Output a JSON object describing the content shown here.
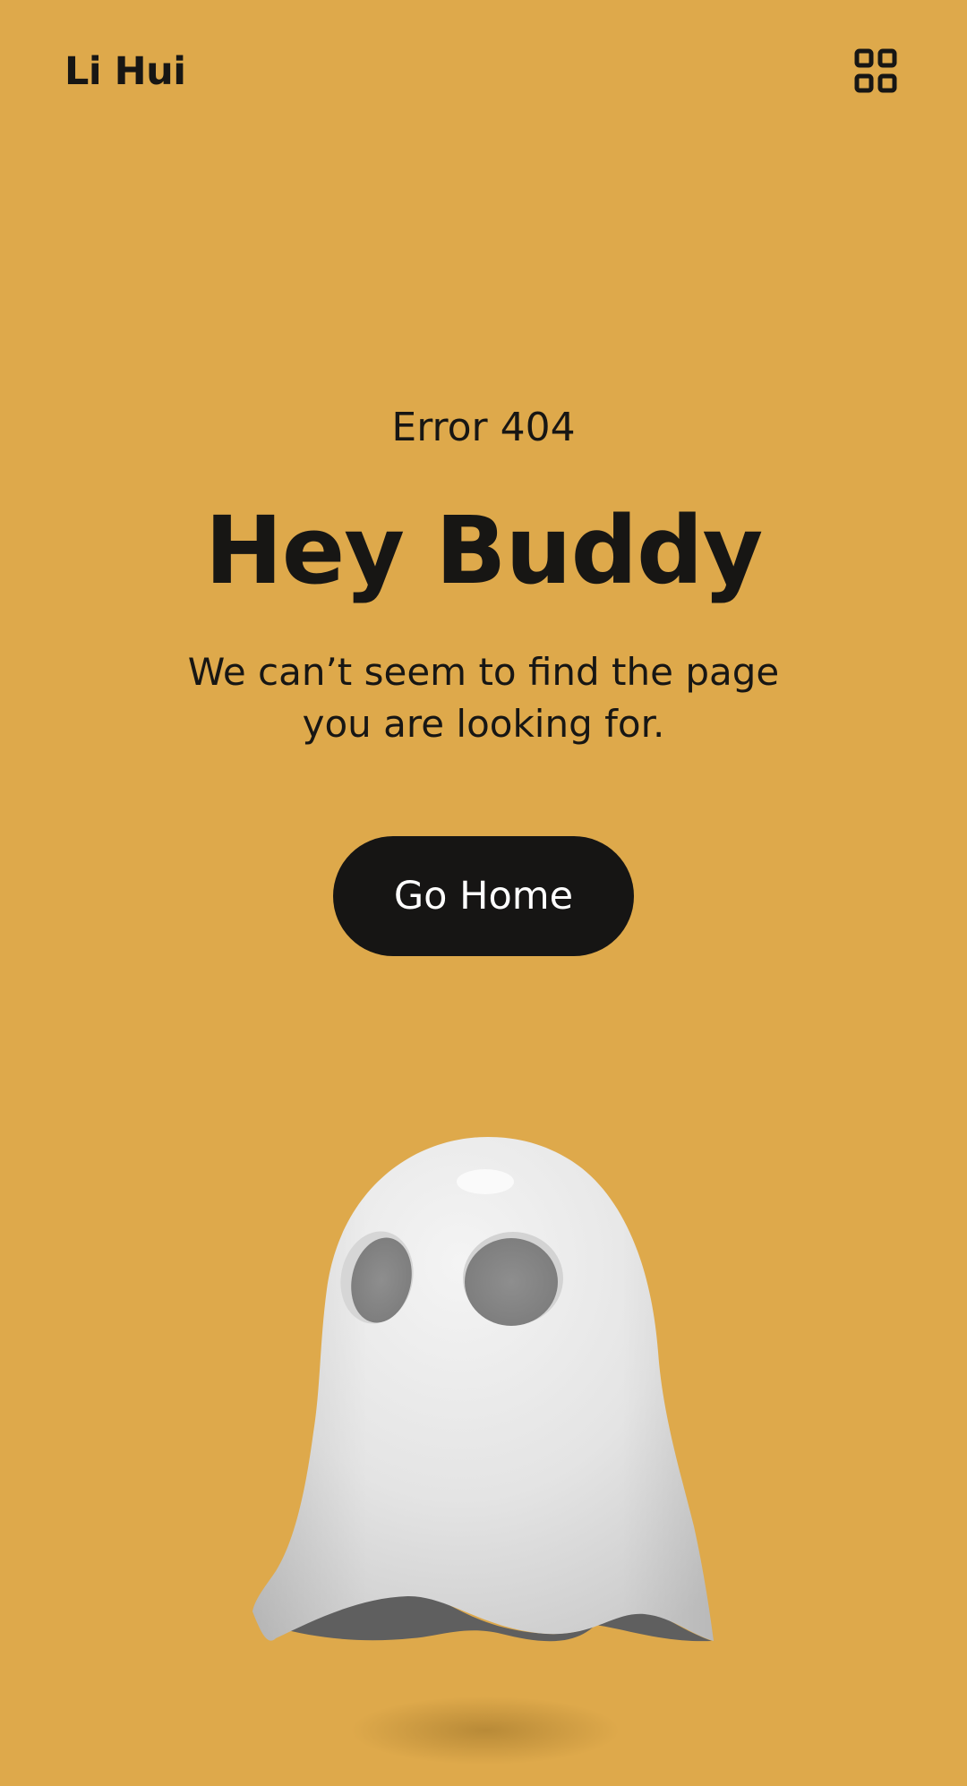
{
  "header": {
    "brand": "Li Hui",
    "menu_icon": "grid-menu-icon"
  },
  "main": {
    "error_code": "Error 404",
    "headline": "Hey Buddy",
    "message": "We can’t seem to find the page you are looking for.",
    "button_label": "Go Home",
    "illustration": "ghost-icon"
  },
  "colors": {
    "background": "#DEA94B",
    "text": "#171614",
    "button_bg": "#161514",
    "button_text": "#FFFFFF"
  }
}
